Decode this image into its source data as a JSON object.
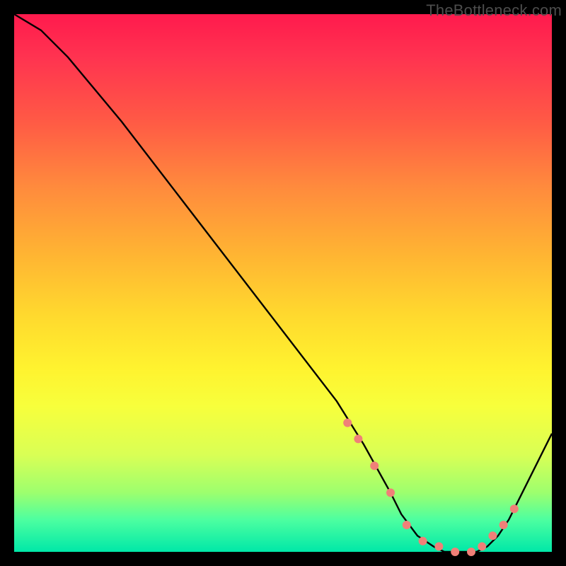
{
  "watermark": "TheBottleneck.com",
  "chart_data": {
    "type": "line",
    "title": "",
    "xlabel": "",
    "ylabel": "",
    "xlim": [
      0,
      100
    ],
    "ylim": [
      0,
      100
    ],
    "series": [
      {
        "name": "bottleneck-curve",
        "x": [
          0,
          5,
          10,
          20,
          30,
          40,
          50,
          60,
          65,
          70,
          72,
          75,
          78,
          80,
          83,
          86,
          88,
          90,
          92,
          95,
          100
        ],
        "values": [
          100,
          97,
          92,
          80,
          67,
          54,
          41,
          28,
          20,
          11,
          7,
          3,
          1,
          0,
          0,
          0,
          1,
          3,
          6,
          12,
          22
        ]
      }
    ],
    "markers": {
      "name": "highlight-dots",
      "x": [
        62,
        64,
        67,
        70,
        73,
        76,
        79,
        82,
        85,
        87,
        89,
        91,
        93
      ],
      "values": [
        24,
        21,
        16,
        11,
        5,
        2,
        1,
        0,
        0,
        1,
        3,
        5,
        8
      ]
    },
    "background_gradient": [
      {
        "stop": 0.0,
        "color": "#ff1a4d"
      },
      {
        "stop": 0.3,
        "color": "#ff8a3d"
      },
      {
        "stop": 0.6,
        "color": "#ffe92e"
      },
      {
        "stop": 0.85,
        "color": "#c6ff55"
      },
      {
        "stop": 1.0,
        "color": "#00e8a8"
      }
    ]
  }
}
